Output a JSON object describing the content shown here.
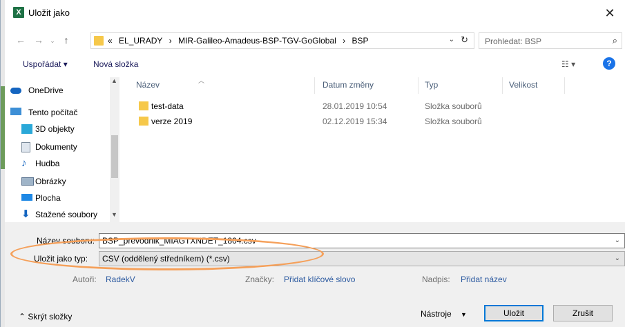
{
  "window": {
    "title": "Uložit jako",
    "app_icon_letter": "X"
  },
  "address": {
    "breadcrumbs": [
      "«",
      "EL_URADY",
      "›",
      "MIR-Galileo-Amadeus-BSP-TGV-GoGlobal",
      "›",
      "BSP"
    ],
    "search_placeholder": "Prohledat: BSP"
  },
  "toolbar": {
    "organize_label": "Uspořádat ▾",
    "new_folder_label": "Nová složka"
  },
  "nav": {
    "items": [
      {
        "label": "OneDrive",
        "icon": "cloud-icon"
      },
      {
        "label": "Tento počítač",
        "icon": "computer-icon"
      },
      {
        "label": "3D objekty",
        "icon": "3d-objects-icon"
      },
      {
        "label": "Dokumenty",
        "icon": "documents-icon"
      },
      {
        "label": "Hudba",
        "icon": "music-icon"
      },
      {
        "label": "Obrázky",
        "icon": "pictures-icon"
      },
      {
        "label": "Plocha",
        "icon": "desktop-icon"
      },
      {
        "label": "Stažené soubory",
        "icon": "download-icon"
      }
    ]
  },
  "list": {
    "columns": [
      "Název",
      "Datum změny",
      "Typ",
      "Velikost"
    ],
    "rows": [
      {
        "name": "test-data",
        "date": "28.01.2019 10:54",
        "type": "Složka souborů",
        "size": ""
      },
      {
        "name": "verze 2019",
        "date": "02.12.2019 15:34",
        "type": "Složka souborů",
        "size": ""
      }
    ]
  },
  "form": {
    "filename_label": "Název souboru:",
    "filename_value": "BSP_prevodnik_MIAGTXNDET_1804.csv",
    "type_label": "Uložit jako typ:",
    "type_value": "CSV (oddělený středníkem) (*.csv)",
    "authors_label": "Autoři:",
    "authors_value": "RadekV",
    "tags_label": "Značky:",
    "tags_value": "Přidat klíčové slovo",
    "caption_label": "Nadpis:",
    "caption_value": "Přidat název"
  },
  "footer": {
    "hide_folders_label": "Skrýt složky",
    "tools_label": "Nástroje",
    "save_label": "Uložit",
    "cancel_label": "Zrušit"
  },
  "colors": {
    "accent": "#0078d7",
    "annotation": "#f5a05a",
    "folder": "#f6c84a"
  }
}
